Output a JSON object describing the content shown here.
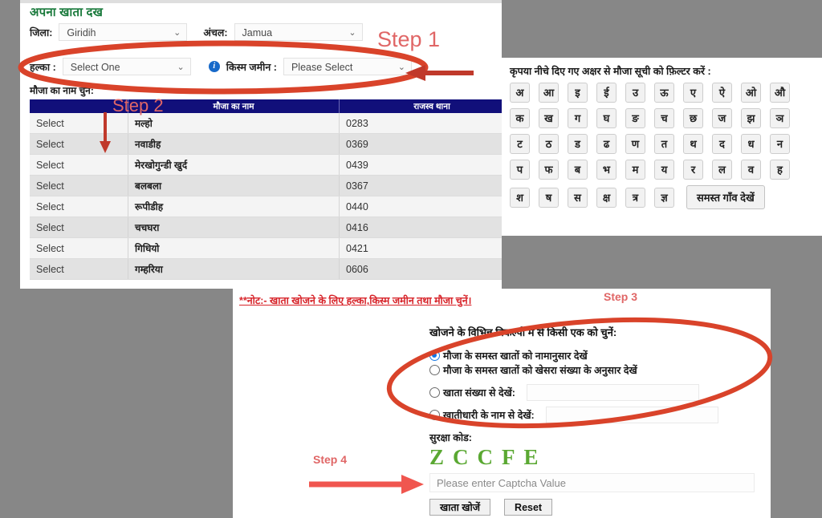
{
  "theme": {
    "background": "#878787",
    "panel_bg": "#ffffff",
    "table_header_bg": "#110f7a",
    "title_green": "#1a7a3c",
    "note_red": "#d7242a",
    "annotation_red": "#d9432a",
    "step_label_color": "#e06666",
    "captcha_green": "#5aa832",
    "radio_blue": "#1076e8"
  },
  "left_panel": {
    "page_title": "अपना खाता दख",
    "fields": {
      "jila_label": "जिला:",
      "jila_value": "Giridih",
      "anchal_label": "अंचल:",
      "anchal_value": "Jamua",
      "halka_label": "हल्का :",
      "halka_value": "Select One",
      "kism_label": "किस्म जमीन :",
      "kism_value": "Please Select",
      "info_icon_char": "i",
      "chevron": "⌄"
    },
    "mauja_select_label": "मौजा का नाम चुनें:",
    "table": {
      "headers": [
        "",
        "मौजा का नाम",
        "राजस्व थाना"
      ],
      "select_text": "Select",
      "rows": [
        {
          "select": "Select",
          "name": "मल्हो",
          "thana": "0283"
        },
        {
          "select": "Select",
          "name": "नवाडीह",
          "thana": "0369"
        },
        {
          "select": "Select",
          "name": "मेरखोगुन्डी खुर्द",
          "thana": "0439"
        },
        {
          "select": "Select",
          "name": "बलबला",
          "thana": "0367"
        },
        {
          "select": "Select",
          "name": "रूपीडीह",
          "thana": "0440"
        },
        {
          "select": "Select",
          "name": "चचघरा",
          "thana": "0416"
        },
        {
          "select": "Select",
          "name": "गिधियो",
          "thana": "0421"
        },
        {
          "select": "Select",
          "name": "गम्हरिया",
          "thana": "0606"
        }
      ]
    }
  },
  "right_panel": {
    "filter_title": "कृपया नीचे दिए गए अक्षर से मौजा सूची को फ़िल्टर करें :",
    "alphabet_rows": [
      [
        "अ",
        "आ",
        "इ",
        "ई",
        "उ",
        "ऊ",
        "ए",
        "ऐ",
        "ओ",
        "औ"
      ],
      [
        "क",
        "ख",
        "ग",
        "घ",
        "ङ",
        "च",
        "छ",
        "ज",
        "झ",
        "ञ"
      ],
      [
        "ट",
        "ठ",
        "ड",
        "ढ",
        "ण",
        "त",
        "थ",
        "द",
        "ध",
        "न"
      ],
      [
        "प",
        "फ",
        "ब",
        "भ",
        "म",
        "य",
        "र",
        "ल",
        "व",
        "ह"
      ],
      [
        "श",
        "ष",
        "स",
        "क्ष",
        "त्र",
        "ज्ञ"
      ]
    ],
    "all_villages_button": "समस्त गाँव देखें"
  },
  "bottom_panel": {
    "note": "**नोट:- खाता खोजने के लिए हल्का,किस्म जमीन तथा मौजा चुनें।",
    "options_title": "खोजने के विभिन्न विकल्पों में से किसी एक को चुनें:",
    "options": [
      {
        "label": "मौजा के समस्त खातों को नामानुसार देखें",
        "selected": true,
        "has_input": false,
        "input_value": ""
      },
      {
        "label": "मौजा के समस्त खातों को खेसरा संख्या के अनुसार देखें",
        "selected": false,
        "has_input": false,
        "input_value": ""
      },
      {
        "label": "खाता संख्या से देखें:",
        "selected": false,
        "has_input": true,
        "input_value": ""
      },
      {
        "label": "खातीधारी के नाम से देखें:",
        "selected": false,
        "has_input": true,
        "input_value": ""
      }
    ],
    "captcha_label": "सुरक्षा कोड:",
    "captcha_text": "ZCCFE",
    "captcha_placeholder": "Please enter Captcha Value",
    "search_button": "खाता खोजें",
    "reset_button": "Reset"
  },
  "annotations": {
    "step1": "Step 1",
    "step2": "Step 2",
    "step3": "Step 3",
    "step4": "Step 4"
  }
}
